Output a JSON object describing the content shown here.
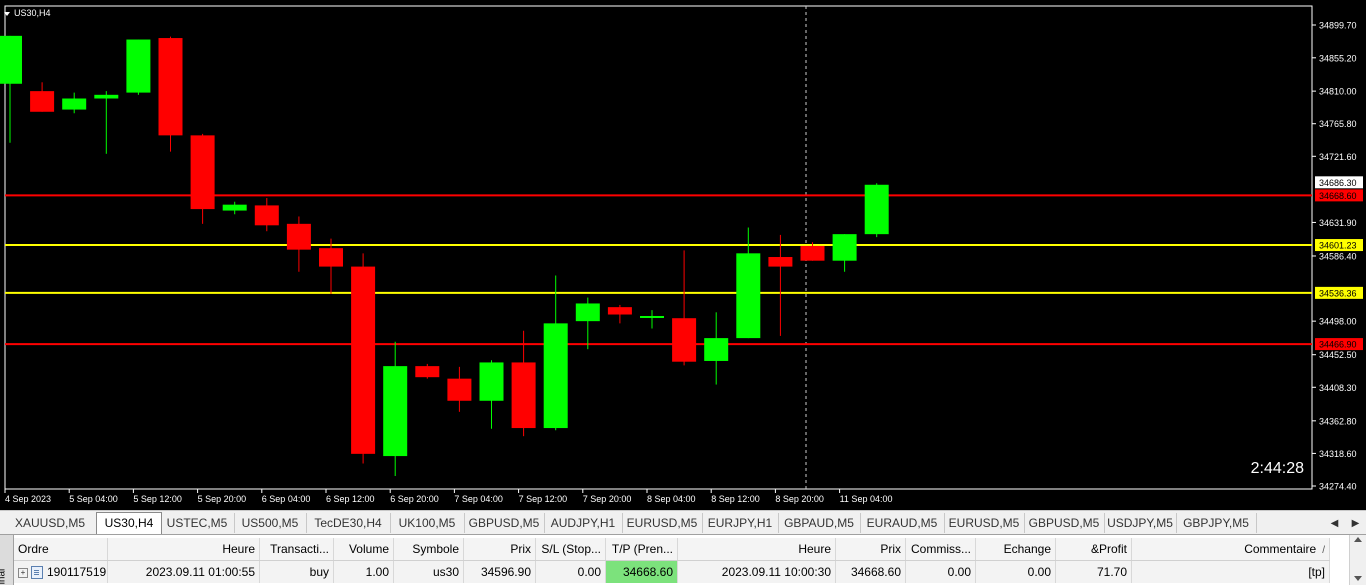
{
  "chart": {
    "symbol_label": "US30,H4",
    "countdown": "2:44:28",
    "colors": {
      "bull": "#00ff00",
      "bear": "#ff0000",
      "bg": "#000000",
      "axis": "#ffffff",
      "red_level": "#ff0000",
      "yellow_level": "#ffff00"
    },
    "price_ticks": [
      "34899.70",
      "34855.20",
      "34810.00",
      "34765.80",
      "34721.60",
      "34631.90",
      "34586.40",
      "34498.00",
      "34452.50",
      "34408.30",
      "34362.80",
      "34318.60",
      "34274.40"
    ],
    "time_ticks": [
      "4 Sep 2023",
      "5 Sep 04:00",
      "5 Sep 12:00",
      "5 Sep 20:00",
      "6 Sep 04:00",
      "6 Sep 12:00",
      "6 Sep 20:00",
      "7 Sep 04:00",
      "7 Sep 12:00",
      "7 Sep 20:00",
      "8 Sep 04:00",
      "8 Sep 12:00",
      "8 Sep 20:00",
      "11 Sep 04:00"
    ],
    "price_labels": [
      {
        "text": "34686.30",
        "style": "white"
      },
      {
        "text": "34668.60",
        "style": "red"
      },
      {
        "text": "34601.23",
        "style": "yellow"
      },
      {
        "text": "34536.36",
        "style": "yellow"
      },
      {
        "text": "34466.90",
        "style": "red"
      }
    ],
    "horizontal_lines": [
      {
        "price": 34668.6,
        "color": "red"
      },
      {
        "price": 34601.23,
        "color": "yellow"
      },
      {
        "price": 34536.36,
        "color": "yellow"
      },
      {
        "price": 34466.9,
        "color": "red"
      }
    ],
    "candles": [
      {
        "o": 34820,
        "h": 34860,
        "l": 34740,
        "c": 34885
      },
      {
        "o": 34810,
        "h": 34822,
        "l": 34782,
        "c": 34782
      },
      {
        "o": 34785,
        "h": 34808,
        "l": 34780,
        "c": 34800
      },
      {
        "o": 34800,
        "h": 34810,
        "l": 34725,
        "c": 34805
      },
      {
        "o": 34808,
        "h": 34880,
        "l": 34805,
        "c": 34880
      },
      {
        "o": 34882,
        "h": 34884,
        "l": 34728,
        "c": 34750
      },
      {
        "o": 34750,
        "h": 34752,
        "l": 34630,
        "c": 34650
      },
      {
        "o": 34648,
        "h": 34660,
        "l": 34643,
        "c": 34656
      },
      {
        "o": 34655,
        "h": 34665,
        "l": 34620,
        "c": 34628
      },
      {
        "o": 34630,
        "h": 34640,
        "l": 34565,
        "c": 34595
      },
      {
        "o": 34597,
        "h": 34610,
        "l": 34535,
        "c": 34572
      },
      {
        "o": 34572,
        "h": 34590,
        "l": 34305,
        "c": 34318
      },
      {
        "o": 34315,
        "h": 34470,
        "l": 34288,
        "c": 34437
      },
      {
        "o": 34437,
        "h": 34440,
        "l": 34420,
        "c": 34422
      },
      {
        "o": 34420,
        "h": 34436,
        "l": 34375,
        "c": 34390
      },
      {
        "o": 34390,
        "h": 34445,
        "l": 34352,
        "c": 34442
      },
      {
        "o": 34442,
        "h": 34485,
        "l": 34342,
        "c": 34353
      },
      {
        "o": 34353,
        "h": 34560,
        "l": 34350,
        "c": 34495
      },
      {
        "o": 34498,
        "h": 34530,
        "l": 34460,
        "c": 34522
      },
      {
        "o": 34517,
        "h": 34520,
        "l": 34495,
        "c": 34507
      },
      {
        "o": 34505,
        "h": 34513,
        "l": 34488,
        "c": 34505
      },
      {
        "o": 34502,
        "h": 34594,
        "l": 34438,
        "c": 34443
      },
      {
        "o": 34444,
        "h": 34510,
        "l": 34412,
        "c": 34475
      },
      {
        "o": 34475,
        "h": 34625,
        "l": 34475,
        "c": 34590
      },
      {
        "o": 34585,
        "h": 34615,
        "l": 34478,
        "c": 34572
      },
      {
        "o": 34600,
        "h": 34605,
        "l": 34580,
        "c": 34580
      },
      {
        "o": 34580,
        "h": 34600,
        "l": 34565,
        "c": 34616
      },
      {
        "o": 34616,
        "h": 34685,
        "l": 34612,
        "c": 34683
      }
    ]
  },
  "tabs": [
    "XAUUSD,M5",
    "US30,H4",
    "USTEC,M5",
    "US500,M5",
    "TecDE30,H4",
    "UK100,M5",
    "GBPUSD,M5",
    "AUDJPY,H1",
    "EURUSD,M5",
    "EURJPY,H1",
    "GBPAUD,M5",
    "EURAUD,M5",
    "EURUSD,M5",
    "GBPUSD,M5",
    "USDJPY,M5",
    "GBPJPY,M5"
  ],
  "active_tab": "US30,H4",
  "terminal": {
    "side_label": "inal",
    "headers": [
      "Ordre",
      "Heure",
      "Transacti...",
      "Volume",
      "Symbole",
      "Prix",
      "S/L (Stop...",
      "T/P (Pren...",
      "Heure",
      "Prix",
      "Commiss...",
      "Echange",
      "&Profit",
      "Commentaire"
    ],
    "row": [
      "190117519",
      "2023.09.11 01:00:55",
      "buy",
      "1.00",
      "us30",
      "34596.90",
      "0.00",
      "34668.60",
      "2023.09.11 10:00:30",
      "34668.60",
      "0.00",
      "0.00",
      "71.70",
      "[tp]"
    ]
  }
}
